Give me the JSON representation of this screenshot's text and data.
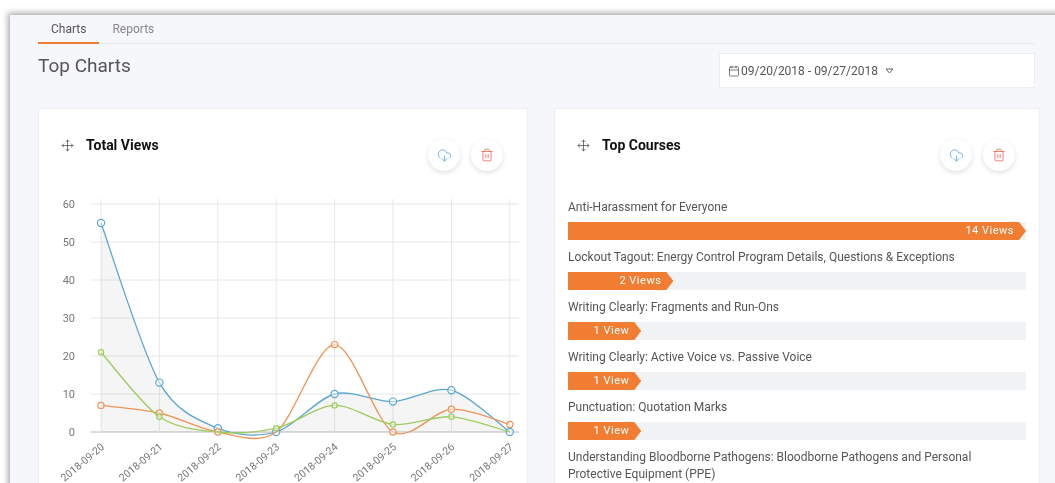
{
  "tabs": [
    {
      "label": "Charts",
      "selected": true
    },
    {
      "label": "Reports",
      "selected": false
    }
  ],
  "page_title": "Top Charts",
  "date_range": {
    "value": "09/20/2018 - 09/27/2018"
  },
  "cards": [
    {
      "kind": "chart",
      "title": "Total Views",
      "chart_data": {
        "type": "line",
        "categories": [
          "2018-09-20",
          "2018-09-21",
          "2018-09-22",
          "2018-09-23",
          "2018-09-24",
          "2018-09-25",
          "2018-09-26",
          "2018-09-27"
        ],
        "ylim": [
          0,
          60
        ],
        "grid": true,
        "yticks": [
          0,
          10,
          20,
          30,
          40,
          50,
          60
        ],
        "series": [
          {
            "color": "#5ba7cf",
            "marker": "circle",
            "values": [
              55,
              13,
              1,
              0,
              10,
              8,
              11,
              0
            ]
          },
          {
            "color": "#ef9458",
            "marker": "circle",
            "values": [
              7,
              5,
              0,
              0,
              23,
              0,
              6,
              2
            ]
          },
          {
            "color": "#9dcb5c",
            "marker": "circle",
            "values": [
              21,
              4,
              0,
              1,
              7,
              2,
              4,
              0
            ]
          }
        ]
      }
    },
    {
      "kind": "bars",
      "title": "Top Courses",
      "courses": [
        {
          "name": "Anti-Harassment for Everyone",
          "views": "14 Views",
          "level": 1.0
        },
        {
          "name": "Lockout Tagout: Energy Control Program Details, Questions & Exceptions",
          "views": "2 Views",
          "level": 0.23
        },
        {
          "name": "Writing Clearly: Fragments and Run-Ons",
          "views": "1 View",
          "level": 0.16
        },
        {
          "name": "Writing Clearly: Active Voice vs. Passive Voice",
          "views": "1 View",
          "level": 0.16
        },
        {
          "name": "Punctuation: Quotation Marks",
          "views": "1 View",
          "level": 0.16
        },
        {
          "name": "Understanding Bloodborne Pathogens: Bloodborne Pathogens and Personal Protective Equipment (PPE)"
        }
      ]
    }
  ]
}
